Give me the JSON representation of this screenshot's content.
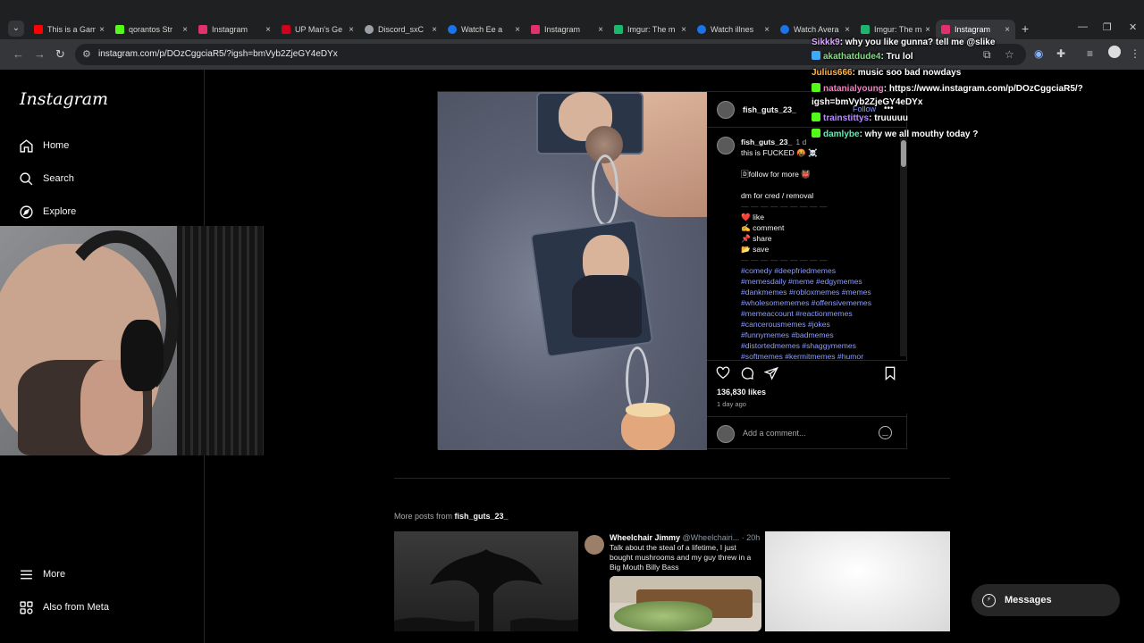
{
  "browser": {
    "tabs": [
      {
        "title": "This is a Gam",
        "color": "#ff0000"
      },
      {
        "title": "qorantos Str",
        "color": "#53fc18"
      },
      {
        "title": "Instagram",
        "color": "#e1306c"
      },
      {
        "title": "UP Man's Ge",
        "color": "#d0021b"
      },
      {
        "title": "Discord_sxC",
        "color": "#9aa0a6"
      },
      {
        "title": "Watch Ee a",
        "color": "#1a73e8"
      },
      {
        "title": "Instagram",
        "color": "#e1306c"
      },
      {
        "title": "Imgur: The m",
        "color": "#1bb76e"
      },
      {
        "title": "Watch illnes",
        "color": "#1a73e8"
      },
      {
        "title": "Watch Avera",
        "color": "#1a73e8"
      },
      {
        "title": "Imgur: The m",
        "color": "#1bb76e"
      },
      {
        "title": "Instagram",
        "color": "#e1306c"
      }
    ],
    "url": "instagram.com/p/DOzCggciaR5/?igsh=bmVyb2ZjeGY4eDYx"
  },
  "sidebar": {
    "logo": "Instagram",
    "items": [
      {
        "label": "Home",
        "icon": "home-icon"
      },
      {
        "label": "Search",
        "icon": "search-icon"
      },
      {
        "label": "Explore",
        "icon": "compass-icon"
      }
    ],
    "bottom_items": [
      {
        "label": "More",
        "icon": "hamburger-icon"
      },
      {
        "label": "Also from Meta",
        "icon": "meta-icon"
      }
    ]
  },
  "post": {
    "username": "fish_guts_23_",
    "follow_label": "Follow",
    "more_label": "•••",
    "caption": {
      "username": "fish_guts_23_",
      "time": "1 d",
      "line1": "this is FUCKED 🤬 ☠️",
      "line2": "🄳follow for more 👹",
      "line3": "dm for cred / removal",
      "separator": "— — — — — — — — —",
      "like": "❤️ like",
      "comment": "✍️ comment",
      "share": "📌 share",
      "save": "📂 save",
      "separator2": "— — — — — — — — —",
      "hashtags": [
        "#comedy #deepfriedmemes",
        "#memesdaily #meme #edgymemes",
        "#dankmemes #robloxmemes #memes",
        "#wholesomememes #offensivememes",
        "#memeaccount #reactionmemes",
        "#cancerousmemes #jokes",
        "#funnymemes #badmemes",
        "#distortedmemes #shaggymemes",
        "#softmemes #kermitmemes #humor"
      ]
    },
    "likes": "136,830 likes",
    "ago": "1 day ago",
    "comment_placeholder": "Add a comment..."
  },
  "more_posts": {
    "prefix": "More posts from ",
    "username": "fish_guts_23_",
    "tweet": {
      "name": "Wheelchair Jimmy",
      "handle": "@Wheelchairi... · 20h",
      "text": "Talk about the steal of a lifetime, I just bought mushrooms and my guy threw in a Big Mouth Billy Bass"
    }
  },
  "chat": [
    {
      "user": "Sikkk9",
      "color": "#d7a6ff",
      "msg": ": why you like gunna? tell me @slike",
      "badge": ""
    },
    {
      "user": "akathatdude4",
      "color": "#7ee07e",
      "msg": ": Tru lol",
      "badge": "#3fa9f5"
    },
    {
      "user": "Julius666",
      "color": "#ffb347",
      "msg": ": music soo bad nowdays",
      "badge": ""
    },
    {
      "user": "natanialyoung",
      "color": "#ff7ac6",
      "msg": ": https://www.instagram.com/p/DOzCggciaR5/?",
      "badge": "#53fc18"
    },
    {
      "user": "",
      "color": "#ffffff",
      "msg": "igsh=bmVyb2ZjeGY4eDYx",
      "badge": ""
    },
    {
      "user": "trainstittys",
      "color": "#b88cff",
      "msg": ": truuuuu",
      "badge": "#53fc18"
    },
    {
      "user": "damlybe",
      "color": "#6ee7b7",
      "msg": ": why we all mouthy today ?",
      "badge": "#53fc18"
    }
  ],
  "messages": {
    "label": "Messages"
  }
}
